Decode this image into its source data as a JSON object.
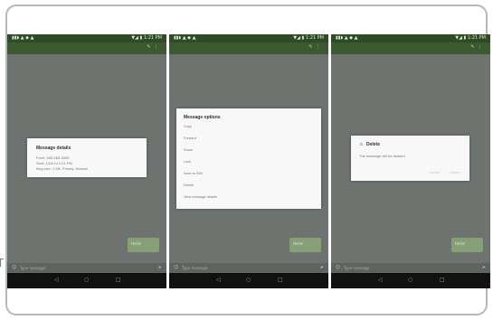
{
  "phones": [
    {
      "status": {
        "left": "▮▮◗ ▲ ◆ ▲",
        "right": "▼◢ ▮ 1:21 PM"
      },
      "action_bar": {
        "title": "",
        "icons": "✎ ⋮"
      },
      "dialog": {
        "type": "details",
        "title": "Message details",
        "lines": [
          "From: 555-555-5555",
          "Sent: 1/24/14 1:21 PM",
          "Msg size: 1 KB, Priority: Normal"
        ]
      },
      "bubble_text": "Hello!",
      "input_hint": "Type message",
      "input_left_icon": "☺",
      "input_right_icon": "➤"
    },
    {
      "status": {
        "left": "▮▮◗ ▲ ◆ ▲",
        "right": "▼◢ ▮ 1:21 PM"
      },
      "action_bar": {
        "title": "",
        "icons": "✎ ⋮"
      },
      "dialog": {
        "type": "options",
        "title": "Message options",
        "options": [
          "Copy",
          "Forward",
          "Share",
          "Lock",
          "Save to SIM",
          "Delete",
          "View message details"
        ]
      },
      "bubble_text": "Hello!",
      "input_hint": "Type message",
      "input_left_icon": "☺",
      "input_right_icon": "➤"
    },
    {
      "status": {
        "left": "▮▮◗ ▲ ◆ ▲",
        "right": "▼◢ ▮ 1:21 PM"
      },
      "action_bar": {
        "title": "",
        "icons": "✎ ⋮"
      },
      "dialog": {
        "type": "delete",
        "title": "Delete",
        "message": "The message will be deleted.",
        "cancel": "Cancel",
        "delete": "Delete"
      },
      "bubble_text": "Hello!",
      "input_hint": "Type message",
      "input_left_icon": "☺",
      "input_right_icon": "➤"
    }
  ],
  "nav": {
    "back": "◁",
    "home": "○",
    "recent": "□"
  }
}
